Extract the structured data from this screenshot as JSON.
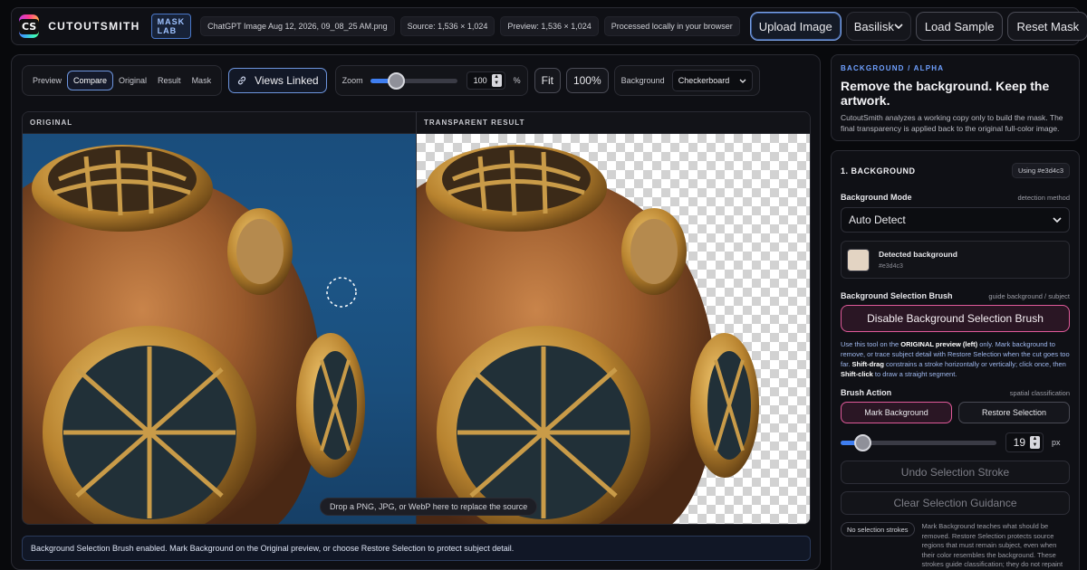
{
  "header": {
    "logo_text": "CS",
    "brand": "CUTOUTSMITH",
    "badge": "MASK LAB",
    "filename": "ChatGPT Image Aug 12, 2026, 09_08_25 AM.png",
    "source": "Source: 1,536 × 1,024",
    "preview": "Preview: 1,536 × 1,024",
    "processed": "Processed locally in your browser",
    "upload_label": "Upload Image",
    "model_value": "Basilisk",
    "load_sample_label": "Load Sample",
    "reset_mask_label": "Reset Mask"
  },
  "toolbar": {
    "view_modes": [
      "Preview",
      "Compare",
      "Original",
      "Result",
      "Mask"
    ],
    "active_view": "Compare",
    "views_linked_label": "Views Linked",
    "zoom_label": "Zoom",
    "zoom_value": "100",
    "zoom_unit": "%",
    "zoom_fraction": 0.3,
    "fit_label": "Fit",
    "hundred_label": "100%",
    "background_label": "Background",
    "background_value": "Checkerboard"
  },
  "compare": {
    "left_title": "ORIGINAL",
    "right_title": "TRANSPARENT RESULT",
    "drop_hint": "Drop a PNG, JPG, or WebP here to replace the source"
  },
  "status_message": "Background Selection Brush enabled. Mark Background on the Original preview, or choose Restore Selection to protect subject detail.",
  "side": {
    "eyebrow": "BACKGROUND / ALPHA",
    "title": "Remove the background. Keep the artwork.",
    "description": "CutoutSmith analyzes a working copy only to build the mask. The final transparency is applied back to the original full-color image.",
    "section_title": "1. BACKGROUND",
    "using_pill": "Using #e3d4c3",
    "mode_label": "Background Mode",
    "mode_hint": "detection method",
    "mode_value": "Auto Detect",
    "detected_title": "Detected background",
    "detected_hex": "#e3d4c3",
    "detected_color": "#e3d4c3",
    "brush_label": "Background Selection Brush",
    "brush_hint": "guide background / subject",
    "brush_button": "Disable Background Selection Brush",
    "help_1": "Use this tool on the ",
    "help_bold_1": "ORIGINAL preview (left)",
    "help_2": " only. Mark background to remove, or trace subject detail with Restore Selection when the cut goes too far. ",
    "help_bold_2": "Shift-drag",
    "help_3": " constrains a stroke horizontally or vertically; click once, then ",
    "help_bold_3": "Shift-click",
    "help_4": " to draw a straight segment.",
    "action_label": "Brush Action",
    "action_hint": "spatial classification",
    "mark_bg_label": "Mark Background",
    "restore_label": "Restore Selection",
    "brush_size": "19",
    "brush_unit": "px",
    "brush_fraction": 0.14,
    "undo_label": "Undo Selection Stroke",
    "clear_label": "Clear Selection Guidance",
    "no_strokes": "No selection strokes",
    "note": "Mark Background teaches what should be removed. Restore Selection protects source regions that must remain subject, even when their color resembles the background. These strokes guide classification; they do not repaint the"
  },
  "colors": {
    "accent": "#3f7ef0",
    "pink": "#e05a9a"
  }
}
